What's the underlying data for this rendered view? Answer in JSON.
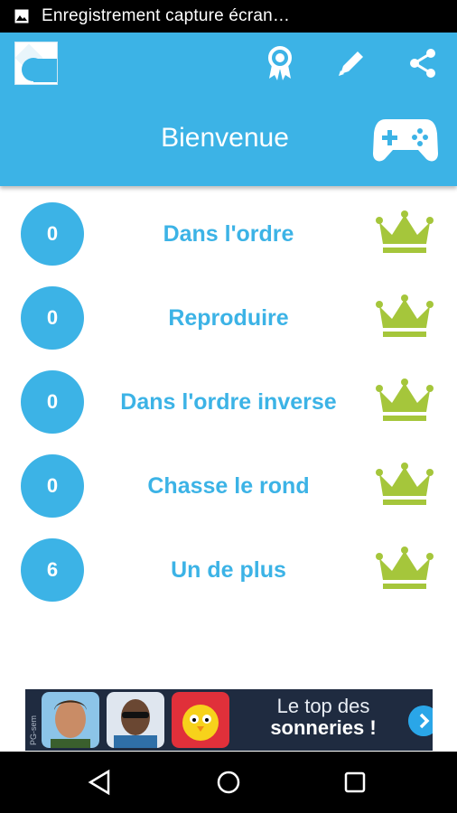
{
  "status_bar": {
    "title": "Enregistrement capture écran…",
    "icon": "image-icon"
  },
  "app_bar": {
    "colors": {
      "primary": "#3cb3e6",
      "accent_green": "#a5c63b"
    },
    "icons": [
      "app-logo",
      "award-icon",
      "pencil-icon",
      "share-icon",
      "gamepad-icon"
    ],
    "welcome": "Bienvenue"
  },
  "games": [
    {
      "score": "0",
      "label": "Dans l'ordre"
    },
    {
      "score": "0",
      "label": "Reproduire"
    },
    {
      "score": "0",
      "label": "Dans l'ordre inverse"
    },
    {
      "score": "0",
      "label": "Chasse le rond"
    },
    {
      "score": "6",
      "label": "Un de plus"
    }
  ],
  "ad": {
    "tag": "PG-sem",
    "line1": "Le top des",
    "line2": "sonneries !"
  },
  "nav_bar": {
    "icons": [
      "back-icon",
      "home-icon",
      "recents-icon"
    ]
  }
}
